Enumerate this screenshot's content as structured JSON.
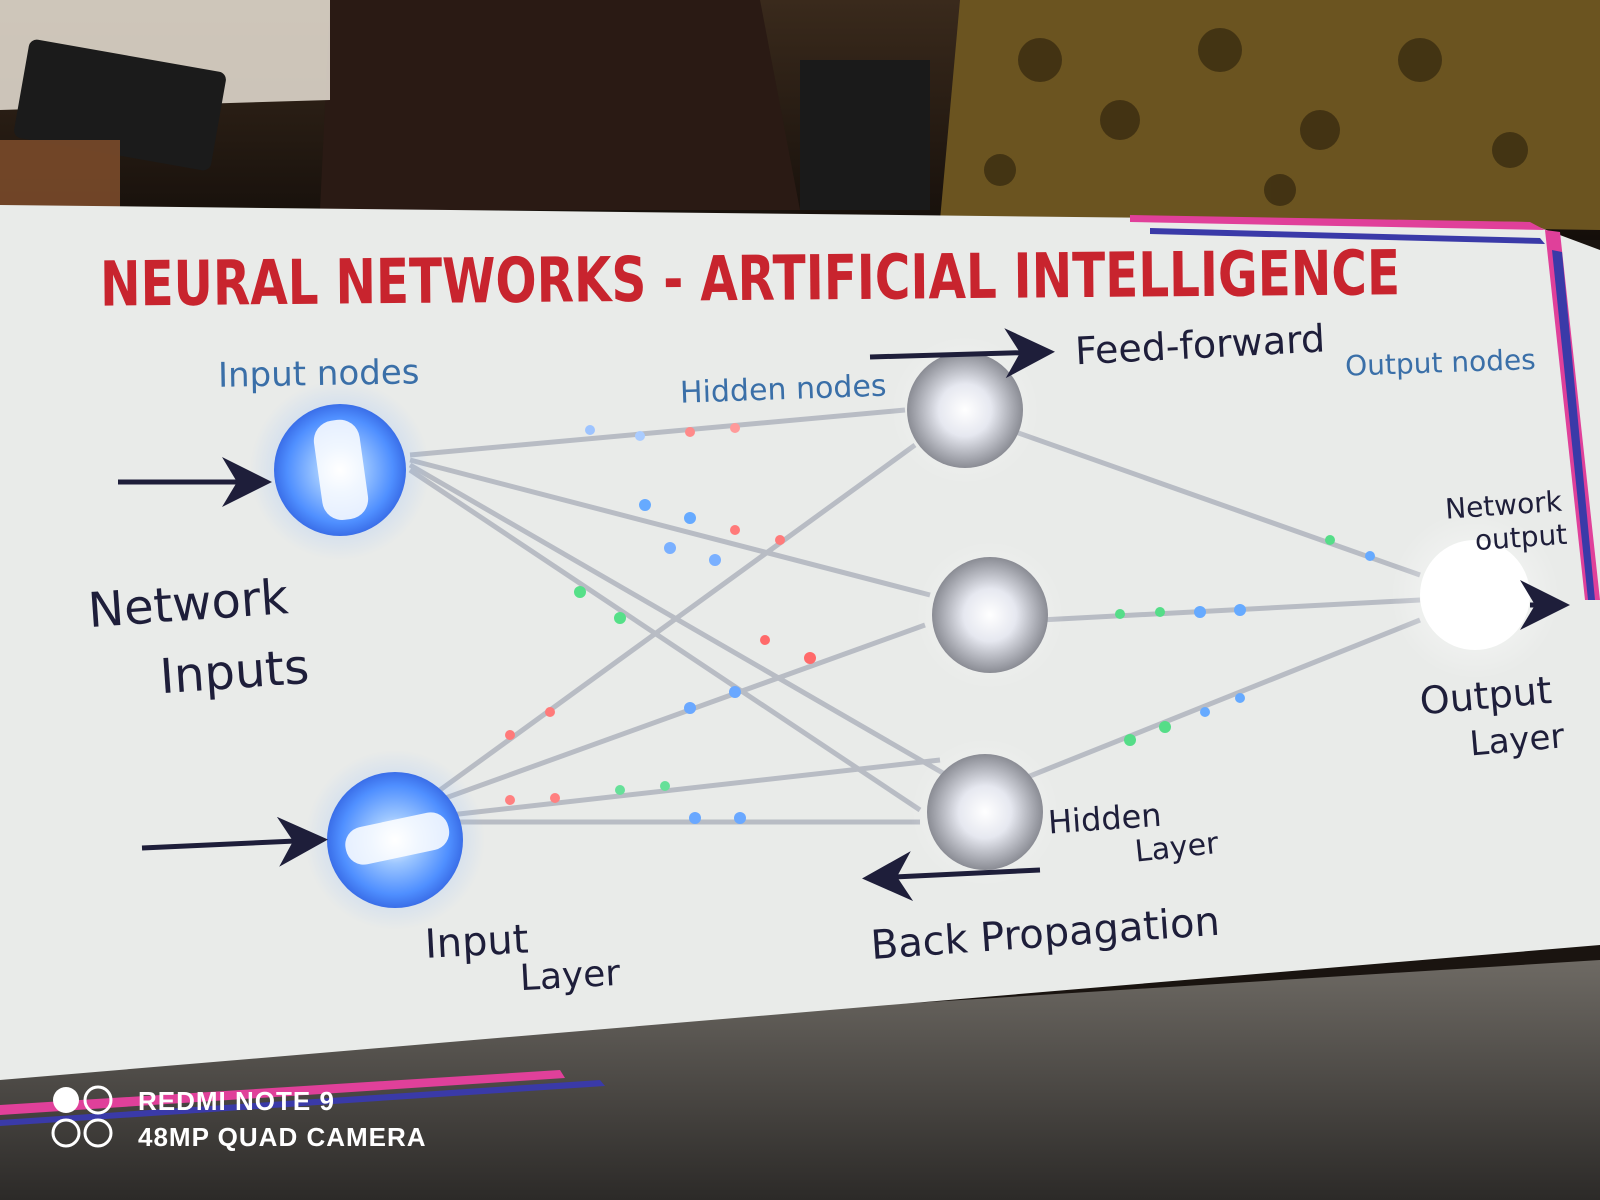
{
  "poster": {
    "title": "NEURAL NETWORKS - ARTIFICIAL INTELLIGENCE",
    "labels": {
      "input_nodes": "Input nodes",
      "hidden_nodes": "Hidden nodes",
      "output_nodes": "Output nodes",
      "feed_forward": "Feed-forward",
      "network_inputs_1": "Network",
      "network_inputs_2": "Inputs",
      "input_layer_1": "Input",
      "input_layer_2": "Layer",
      "hidden_layer_1": "Hidden",
      "hidden_layer_2": "Layer",
      "output_layer_1": "Output",
      "output_layer_2": "Layer",
      "network_output_1": "Network",
      "network_output_2": "output",
      "back_propagation": "Back Propagation"
    },
    "colors": {
      "title": "#c8242e",
      "blue_label": "#3a6fa8",
      "dark_label": "#1e1e3a",
      "board": "#e9ebe9",
      "input_led": "#5aa0ff",
      "hidden_led": "#f2f4ff",
      "border_pink": "#e0409a",
      "border_blue": "#3a3aa8"
    }
  },
  "watermark": {
    "line1": "REDMI NOTE 9",
    "line2": "48MP QUAD CAMERA",
    "icon": "camera-lens-icon"
  }
}
